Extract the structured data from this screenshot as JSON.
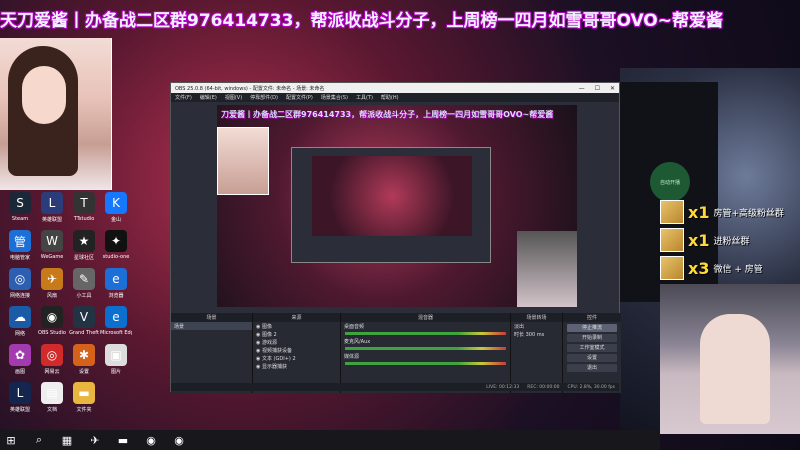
{
  "banner": {
    "text": "天刀爱酱丨办备战二区群976414733，帮派收战斗分子，上周榜一四月如雪哥哥OVO~帮爱酱"
  },
  "desktop": {
    "icons": [
      {
        "label": "Steam",
        "color": "#1b2838",
        "glyph": "S"
      },
      {
        "label": "英雄联盟",
        "color": "#2a3c7a",
        "glyph": "L"
      },
      {
        "label": "TTstudio",
        "color": "#333",
        "glyph": "T"
      },
      {
        "label": "金山",
        "color": "#1677ff",
        "glyph": "K"
      },
      {
        "label": "电脑管家",
        "color": "#1c6fd6",
        "glyph": "管"
      },
      {
        "label": "WeGame",
        "color": "#444",
        "glyph": "W"
      },
      {
        "label": "星球社区",
        "color": "#222",
        "glyph": "★"
      },
      {
        "label": "studio-one",
        "color": "#111",
        "glyph": "✦"
      },
      {
        "label": "网络连接",
        "color": "#2d5fb0",
        "glyph": "◎"
      },
      {
        "label": "风扇",
        "color": "#c77a1a",
        "glyph": "✈"
      },
      {
        "label": "小工具",
        "color": "#666",
        "glyph": "✎"
      },
      {
        "label": "浏览器",
        "color": "#1b6fd6",
        "glyph": "e"
      },
      {
        "label": "网络",
        "color": "#1a5aa6",
        "glyph": "☁"
      },
      {
        "label": "OBS Studio",
        "color": "#222",
        "glyph": "◉"
      },
      {
        "label": "Grand Theft",
        "color": "#234",
        "glyph": "V"
      },
      {
        "label": "Microsoft Edge",
        "color": "#0b6fcf",
        "glyph": "e"
      },
      {
        "label": "画图",
        "color": "#a33ab0",
        "glyph": "✿"
      },
      {
        "label": "网易云",
        "color": "#d02a2a",
        "glyph": "◎"
      },
      {
        "label": "设置",
        "color": "#d5621b",
        "glyph": "✱"
      },
      {
        "label": "图片",
        "color": "#ddd",
        "glyph": "▣"
      },
      {
        "label": "英雄联盟",
        "color": "#14254f",
        "glyph": "L"
      },
      {
        "label": "文档",
        "color": "#eee",
        "glyph": "▤"
      },
      {
        "label": "文件夹",
        "color": "#e9b640",
        "glyph": "▬"
      }
    ]
  },
  "taskbar": {
    "items": [
      "start-icon",
      "search-icon",
      "taskview-icon",
      "app-icon",
      "folder-icon",
      "app2-icon",
      "app3-icon"
    ],
    "glyphs": [
      "⊞",
      "⌕",
      "▦",
      "✈",
      "▬",
      "◉",
      "◉"
    ]
  },
  "obs": {
    "title": "OBS 25.0.8 (64-bit, windows) - 配置文件: 未命名 - 场景: 未命名",
    "menus": [
      "文件(F)",
      "编辑(E)",
      "视图(V)",
      "停靠部件(D)",
      "配置文件(P)",
      "场景集合(S)",
      "工具(T)",
      "帮助(H)"
    ],
    "preview_banner": "刀爱酱丨办备战二区群976414733，帮派收战斗分子，上周榜一四月如雪哥哥OVO~帮爱酱",
    "docks": {
      "scenes": {
        "header": "场景",
        "items": [
          "场景"
        ]
      },
      "sources": {
        "header": "来源",
        "items": [
          "图像",
          "图像 2",
          "游戏源",
          "视频捕获设备",
          "文本 (GDI+) 2",
          "显示器捕获"
        ]
      },
      "mixer": {
        "header": "混音器",
        "channels": [
          "桌面音频",
          "麦克风/Aux",
          "媒体源"
        ]
      },
      "transitions": {
        "header": "场景转场",
        "type": "淡出",
        "duration_label": "时长",
        "duration": "300 ms"
      },
      "controls": {
        "header": "控件",
        "buttons": [
          "停止推流",
          "开始录制",
          "工作室模式",
          "设置",
          "退出"
        ]
      }
    },
    "status": {
      "live": "LIVE: 00:12:33",
      "rec": "REC: 00:00:00",
      "cpu": "CPU: 2.8%, 30.00 fps"
    }
  },
  "gifts": [
    {
      "count": "x1",
      "label": "房管+高级粉丝群"
    },
    {
      "count": "x1",
      "label": "进粉丝群"
    },
    {
      "count": "x3",
      "label": "微信 + 房管"
    }
  ],
  "side_button": {
    "label": "自动开播"
  }
}
